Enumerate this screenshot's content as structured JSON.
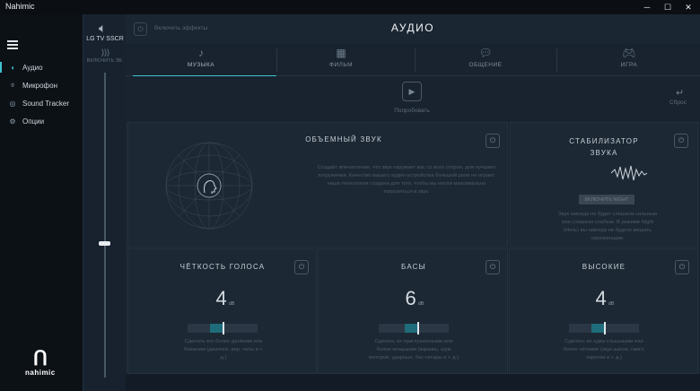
{
  "window": {
    "title": "Nahimic",
    "minimize": "─",
    "maximize": "☐",
    "close": "✕"
  },
  "sidebar": {
    "items": [
      {
        "label": "Аудио",
        "icon": "audio-icon",
        "active": true
      },
      {
        "label": "Микрофон",
        "icon": "microphone-icon",
        "active": false
      },
      {
        "label": "Sound Tracker",
        "icon": "sound-tracker-icon",
        "active": false
      },
      {
        "label": "Опции",
        "icon": "options-icon",
        "active": false
      }
    ],
    "logo_text": "nahimic"
  },
  "device": {
    "name": "LG TV SSCR",
    "sublabel": "ВКЛЮЧИТЬ ЗВ.",
    "volume_fraction": 0.44
  },
  "header": {
    "effects_label": "Включить эффекты",
    "title": "АУДИО"
  },
  "tabs": [
    {
      "label": "МУЗЫКА",
      "icon": "music-note-icon",
      "active": true
    },
    {
      "label": "ФИЛЬМ",
      "icon": "film-icon",
      "active": false
    },
    {
      "label": "ОБЩЕНИЕ",
      "icon": "chat-icon",
      "active": false
    },
    {
      "label": "ИГРА",
      "icon": "gamepad-icon",
      "active": false
    }
  ],
  "actions": {
    "try_label": "Попробовать",
    "reset_label": "Сброс"
  },
  "panels": {
    "surround": {
      "title": "ОБЪЕМНЫЙ ЗВУК",
      "description": "Создаёт впечатление, что звук окружает вас со всех сторон, для лучшего погружения. Качество вашего аудио-устройства большой роли не играет, наша технология создана для того, чтобы вы могли максимально погрузиться в звук."
    },
    "stabilizer": {
      "title": "СТАБИЛИЗАТОР ЗВУКА",
      "button_label": "ВКЛЮЧИТЬ NIGHT",
      "description": "Звук никогда не будет слишком сильным или слишком слабым. В режиме Night (Ночь) вы никогда не будете мешать окружающим."
    },
    "voice": {
      "title": "ЧЁТКОСТЬ ГОЛОСА",
      "value": "4",
      "unit": "dB",
      "level": 0.5,
      "description": "Сделать его более далёким или ближним (диалоги, вер, чаты и т. д.)"
    },
    "bass": {
      "title": "БАСЫ",
      "value": "6",
      "unit": "dB",
      "level": 0.55,
      "description": "Сделать их приглушенными или более мощными (взрывы, шум моторов, ударные, бас-гитары и т. д.)"
    },
    "treble": {
      "title": "ВЫСОКИЕ",
      "value": "4",
      "unit": "dB",
      "level": 0.5,
      "description": "Сделать их едва слышными или более чёткими (звук шагов, свист, тарелки и т. д.)"
    }
  },
  "colors": {
    "accent": "#3fc1d2",
    "background": "#1a2632",
    "sidebar": "#0c1116"
  }
}
